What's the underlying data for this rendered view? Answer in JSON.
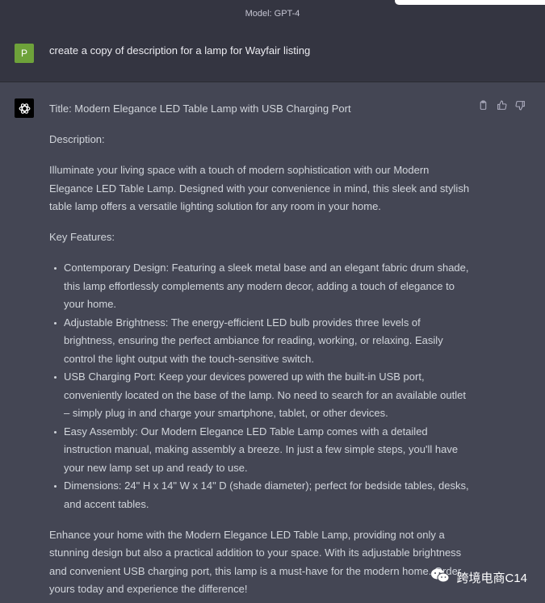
{
  "header": {
    "model_label": "Model: GPT-4"
  },
  "user_message": {
    "avatar_letter": "P",
    "text": "create a copy of description for a lamp for Wayfair listing"
  },
  "assistant_message": {
    "title_line": "Title: Modern Elegance LED Table Lamp with USB Charging Port",
    "description_label": "Description:",
    "intro": "Illuminate your living space with a touch of modern sophistication with our Modern Elegance LED Table Lamp. Designed with your convenience in mind, this sleek and stylish table lamp offers a versatile lighting solution for any room in your home.",
    "features_label": "Key Features:",
    "features": [
      "Contemporary Design: Featuring a sleek metal base and an elegant fabric drum shade, this lamp effortlessly complements any modern decor, adding a touch of elegance to your home.",
      "Adjustable Brightness: The energy-efficient LED bulb provides three levels of brightness, ensuring the perfect ambiance for reading, working, or relaxing. Easily control the light output with the touch-sensitive switch.",
      "USB Charging Port: Keep your devices powered up with the built-in USB port, conveniently located on the base of the lamp. No need to search for an available outlet – simply plug in and charge your smartphone, tablet, or other devices.",
      "Easy Assembly: Our Modern Elegance LED Table Lamp comes with a detailed instruction manual, making assembly a breeze. In just a few simple steps, you'll have your new lamp set up and ready to use.",
      "Dimensions: 24\" H x 14\" W x 14\" D (shade diameter); perfect for bedside tables, desks, and accent tables."
    ],
    "closing": "Enhance your home with the Modern Elegance LED Table Lamp, providing not only a stunning design but also a practical addition to your space. With its adjustable brightness and convenient USB charging port, this lamp is a must-have for the modern home. Order yours today and experience the difference!"
  },
  "icons": {
    "copy": "clipboard-icon",
    "like": "thumbs-up-icon",
    "dislike": "thumbs-down-icon",
    "assistant_avatar": "openai-logo-icon",
    "watermark": "wechat-icon"
  },
  "watermark": {
    "text": "跨境电商C14"
  },
  "colors": {
    "user_bg": "#343541",
    "assistant_bg": "#444654",
    "user_avatar": "#6ea23a"
  }
}
